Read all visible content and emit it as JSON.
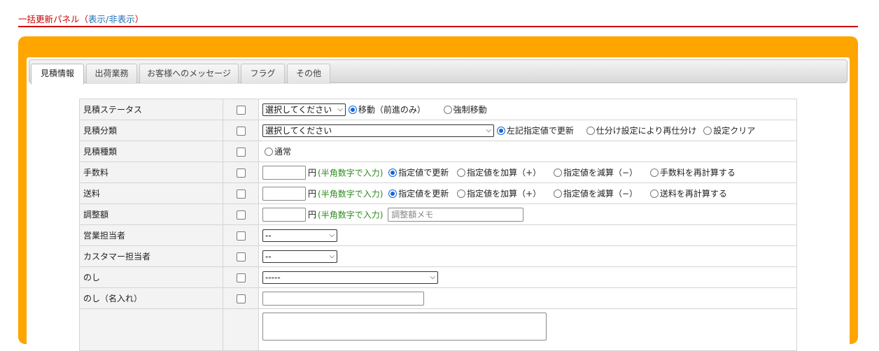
{
  "panel": {
    "title": "一括更新パネル",
    "paren_open": "（",
    "toggle_label": "表示/非表示",
    "paren_close": "）"
  },
  "tabs": [
    {
      "label": "見積情報",
      "active": true
    },
    {
      "label": "出荷業務",
      "active": false
    },
    {
      "label": "お客様へのメッセージ",
      "active": false
    },
    {
      "label": "フラグ",
      "active": false
    },
    {
      "label": "その他",
      "active": false
    }
  ],
  "rows": {
    "status": {
      "label": "見積ステータス",
      "select_value": "選択してください",
      "radios": [
        "移動（前進のみ）",
        "強制移動"
      ],
      "selected_radio": 0
    },
    "category": {
      "label": "見積分類",
      "select_value": "選択してください",
      "radios": [
        "左記指定値で更新",
        "仕分け設定により再仕分け",
        "設定クリア"
      ],
      "selected_radio": 0
    },
    "type": {
      "label": "見積種類",
      "radios": [
        "通常"
      ],
      "selected_radio": -1
    },
    "fee": {
      "label": "手数料",
      "input_value": "",
      "unit": "円",
      "hint": "(半角数字で入力)",
      "radios": [
        "指定値で更新",
        "指定値を加算（+）",
        "指定値を減算（−）",
        "手数料を再計算する"
      ],
      "selected_radio": 0
    },
    "shipping": {
      "label": "送料",
      "input_value": "",
      "unit": "円",
      "hint": "(半角数字で入力)",
      "radios": [
        "指定値を更新",
        "指定値を加算（+）",
        "指定値を減算（−）",
        "送料を再計算する"
      ],
      "selected_radio": 0
    },
    "adjustment": {
      "label": "調整額",
      "input_value": "",
      "unit": "円",
      "hint": "(半角数字で入力)",
      "memo_placeholder": "調整額メモ"
    },
    "sales_rep": {
      "label": "営業担当者",
      "select_value": "--"
    },
    "customer_rep": {
      "label": "カスタマー担当者",
      "select_value": "--"
    },
    "noshi": {
      "label": "のし",
      "select_value": "-----"
    },
    "noshi_name": {
      "label": "のし（名入れ）",
      "input_value": ""
    },
    "extra": {
      "label": ""
    }
  },
  "icons": {
    "select_chevron": "chevron-down-icon"
  },
  "colors": {
    "accent_orange": "#ffa500",
    "title_red": "#cc0000",
    "link_blue": "#1f6fb5",
    "hint_green": "#2e8b1e",
    "radio_blue": "#1565d8"
  }
}
